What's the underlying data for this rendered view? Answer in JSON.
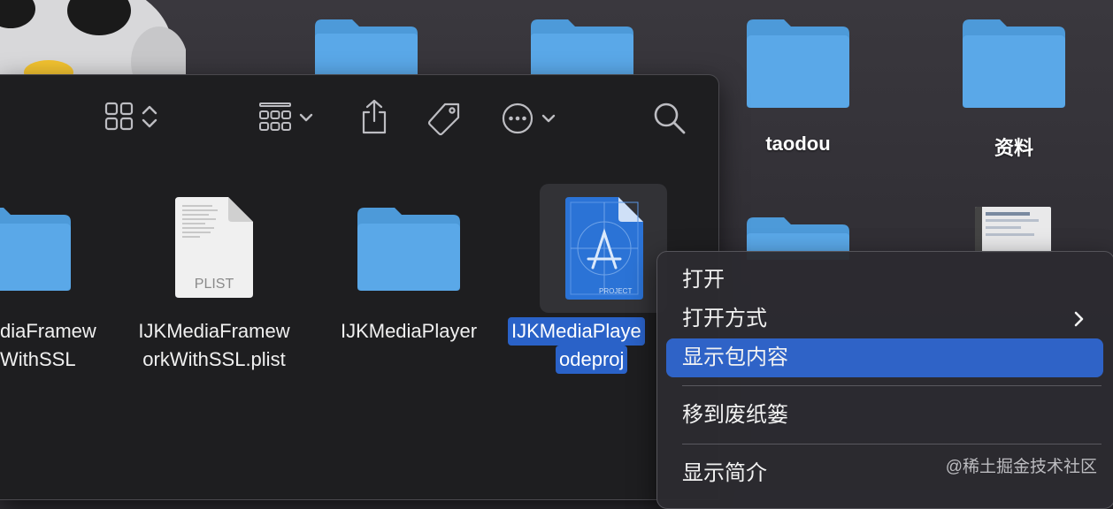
{
  "desktop": {
    "labels": [
      "taodou",
      "资料"
    ]
  },
  "finder": {
    "toolbar": {
      "view_icon": "grid-view-icon",
      "group_icon": "group-by-icon",
      "share_icon": "share-icon",
      "tag_icon": "tag-icon",
      "more_icon": "ellipsis-circle-icon",
      "search_icon": "search-icon"
    },
    "items": [
      {
        "line1": "diaFramew",
        "line2": "WithSSL"
      },
      {
        "line1": "IJKMediaFramew",
        "line2": "orkWithSSL.plist",
        "badge": "PLIST"
      },
      {
        "line1": "IJKMediaPlayer"
      },
      {
        "line1": "IJKMediaPlaye",
        "line2": "odeproj",
        "badge": "PROJECT"
      }
    ]
  },
  "context_menu": {
    "items": [
      "打开",
      "打开方式",
      "显示包内容",
      "移到废纸篓",
      "显示简介"
    ]
  },
  "watermark": "@稀土掘金技术社区",
  "colors": {
    "folder": "#5aa8e8",
    "selection": "#2f63c7"
  }
}
